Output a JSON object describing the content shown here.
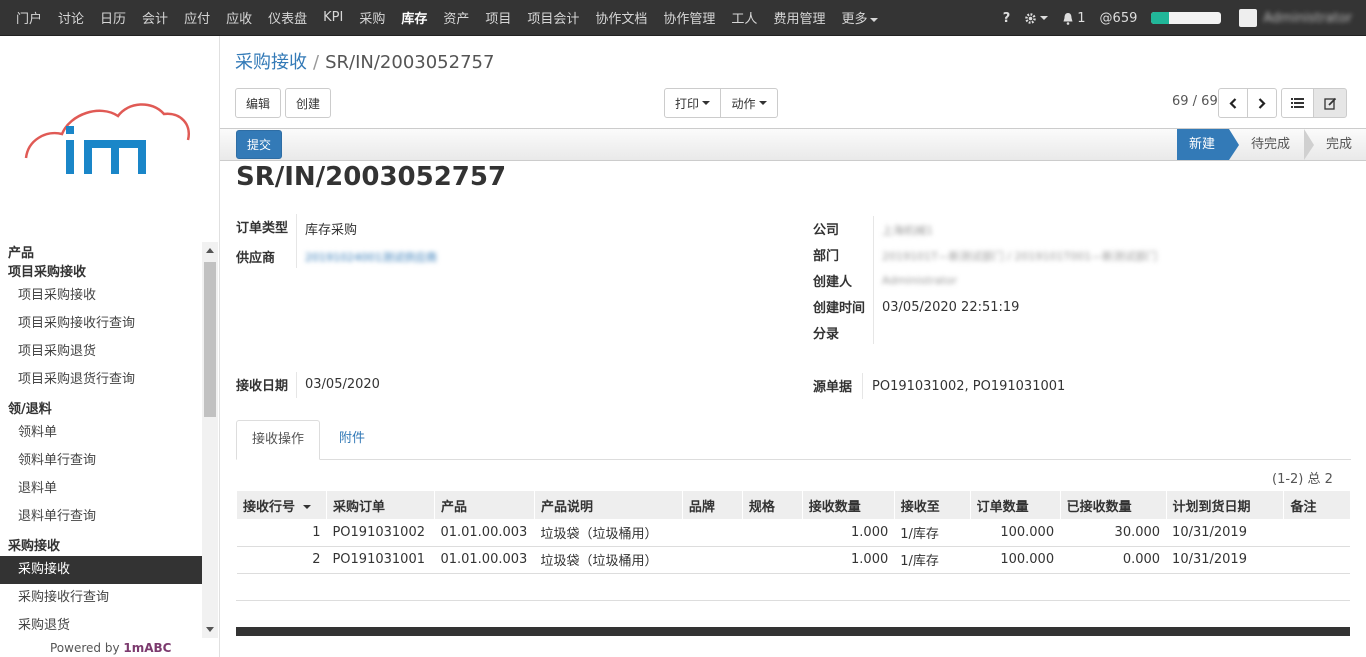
{
  "topnav": {
    "menu": [
      "门户",
      "讨论",
      "日历",
      "会计",
      "应付",
      "应收",
      "仪表盘",
      "KPI",
      "采购",
      "库存",
      "资产",
      "项目",
      "项目会计",
      "协作文档",
      "协作管理",
      "工人",
      "费用管理"
    ],
    "more_label": "更多",
    "active": "库存",
    "help": "?",
    "notif_count": "1",
    "mention_count": "659",
    "progress_pct": 25,
    "user": "Administrator"
  },
  "sidebar": {
    "sections": [
      {
        "title": "产品",
        "items": []
      },
      {
        "title": "项目采购接收",
        "items": [
          "项目采购接收",
          "项目采购接收行查询",
          "项目采购退货",
          "项目采购退货行查询"
        ]
      },
      {
        "title": "领/退料",
        "items": [
          "领料单",
          "领料单行查询",
          "退料单",
          "退料单行查询"
        ]
      },
      {
        "title": "采购接收",
        "items": [
          "采购接收",
          "采购接收行查询",
          "采购退货"
        ]
      }
    ],
    "active_item": "采购接收",
    "powered_prefix": "Powered by ",
    "powered_brand": "1mABC"
  },
  "breadcrumb": {
    "parent": "采购接收",
    "current": "SR/IN/2003052757"
  },
  "toolbar": {
    "edit": "编辑",
    "create": "创建",
    "print": "打印",
    "action": "动作",
    "pager": "69 / 69"
  },
  "statusbar": {
    "submit": "提交",
    "stages": [
      "新建",
      "待完成",
      "完成"
    ],
    "current_stage": "新建"
  },
  "record": {
    "title": "SR/IN/2003052757",
    "order_type_label": "订单类型",
    "order_type": "库存采购",
    "supplier_label": "供应商",
    "supplier": "20191024001测试供应商",
    "company_label": "公司",
    "company": "上海机械1",
    "dept_label": "部门",
    "dept": "2019101T—新测试部门 / 2019101T001—新测试部门",
    "creator_label": "创建人",
    "creator": "Administrator",
    "created_label": "创建时间",
    "created": "03/05/2020 22:51:19",
    "entry_label": "分录",
    "receive_date_label": "接收日期",
    "receive_date": "03/05/2020",
    "source_label": "源单据",
    "source": "PO191031002, PO191031001"
  },
  "tabs": {
    "operations": "接收操作",
    "attachments": "附件"
  },
  "lines": {
    "count": "(1-2) 总 2",
    "headers": [
      "接收行号",
      "采购订单",
      "产品",
      "产品说明",
      "品牌",
      "规格",
      "接收数量",
      "接收至",
      "订单数量",
      "已接收数量",
      "计划到货日期",
      "备注"
    ],
    "rows": [
      [
        "1",
        "PO191031002",
        "01.01.00.003",
        "垃圾袋（垃圾桶用）",
        "",
        "",
        "1.000",
        "1/库存",
        "100.000",
        "30.000",
        "10/31/2019",
        ""
      ],
      [
        "2",
        "PO191031001",
        "01.01.00.003",
        "垃圾袋（垃圾桶用）",
        "",
        "",
        "1.000",
        "1/库存",
        "100.000",
        "0.000",
        "10/31/2019",
        ""
      ]
    ]
  },
  "colors": {
    "accent": "#337ab7",
    "topbar": "#343434",
    "progress": "#21b799",
    "logo_cloud": "#e05a55",
    "logo_text": "#1a86c8"
  }
}
